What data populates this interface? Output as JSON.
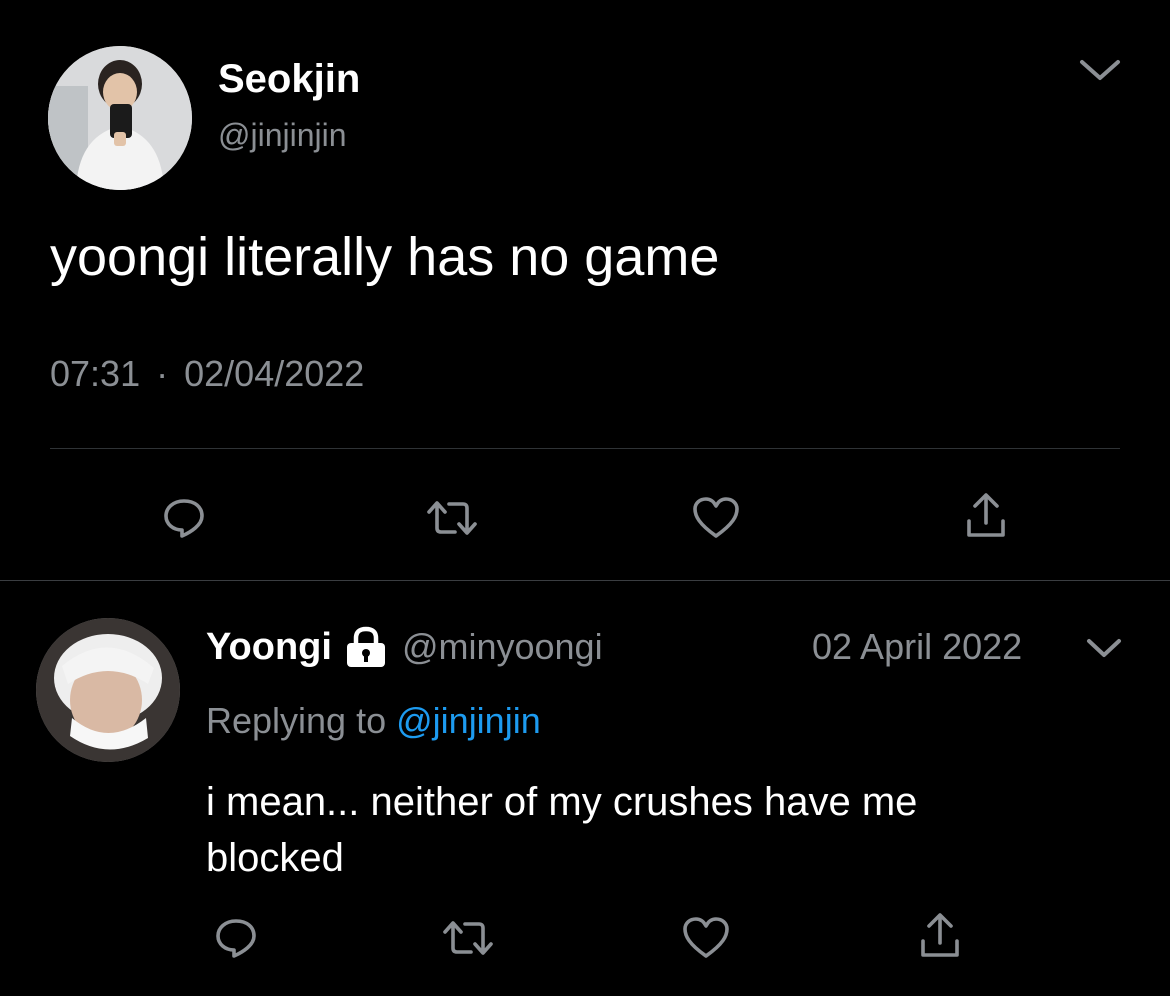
{
  "main_tweet": {
    "author_name": "Seokjin",
    "handle": "@jinjinjin",
    "text": "yoongi literally has no game",
    "time": "07:31",
    "separator": "·",
    "date": "02/04/2022",
    "menu_icon": "chevron-down-icon",
    "actions": [
      "reply-icon",
      "retweet-icon",
      "like-icon",
      "share-icon"
    ]
  },
  "reply_tweet": {
    "author_name": "Yoongi",
    "locked": true,
    "lock_icon": "lock-icon",
    "handle": "@minyoongi",
    "date": "02 April 2022",
    "replying_prefix": "Replying to",
    "replying_to": "@jinjinjin",
    "text_line1": "i mean... neither of my crushes have me",
    "text_line2": "blocked",
    "menu_icon": "chevron-down-icon",
    "actions": [
      "reply-icon",
      "retweet-icon",
      "like-icon",
      "share-icon"
    ]
  },
  "colors": {
    "background": "#000000",
    "text": "#ffffff",
    "muted": "#8b8f94",
    "link": "#1d9bf0",
    "divider": "#2f3336"
  }
}
